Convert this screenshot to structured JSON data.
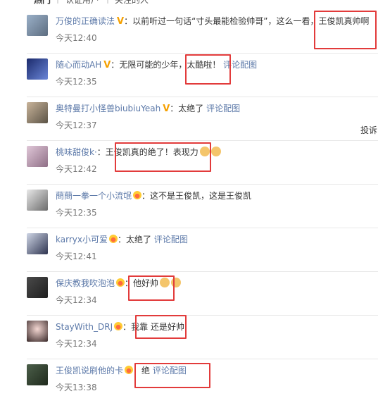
{
  "tabs": {
    "hot": "热门",
    "verified": "认证用户",
    "following": "关注的人"
  },
  "side_label": "投诉",
  "comments": [
    {
      "user": "万俊的正确读法",
      "badge": "V",
      "text": "以前听过一句话“寸头最能检验帅哥”，这么一看，王俊凯真帅啊",
      "link": "",
      "time": "今天12:40"
    },
    {
      "user": "随心而动AH",
      "badge": "V",
      "text": "无限可能的少年，太酷啦！",
      "link": "评论配图",
      "time": "今天12:35"
    },
    {
      "user": "奥特曼打小怪兽biubiuYeah",
      "badge": "V",
      "text": "太绝了",
      "link": "评论配图",
      "time": "今天12:37"
    },
    {
      "user": "桃味甜俊k·",
      "badge": "",
      "text": "王俊凯真的绝了！表现力",
      "link": "",
      "time": "今天12:42",
      "emoji_count": 2
    },
    {
      "user": "蔄蔄一拳一个小流氓",
      "badge": "crown",
      "text": "这不是王俊凯，这是王俊凯",
      "link": "",
      "time": "今天12:35"
    },
    {
      "user": "karryx小可爱",
      "badge": "crown",
      "text": "太绝了",
      "link": "评论配图",
      "time": "今天12:41"
    },
    {
      "user": "保庆教我吹泡泡",
      "badge": "crown",
      "text": "他好帅",
      "link": "",
      "time": "今天12:34",
      "emoji_count": 2
    },
    {
      "user": "StayWith_DRJ",
      "badge": "crown",
      "text": "我靠 还是好帅",
      "link": "",
      "time": "今天12:34"
    },
    {
      "user": "王俊凯说刷他的卡",
      "badge": "crown",
      "text": "绝",
      "link": "评论配图",
      "time": "今天13:38"
    }
  ],
  "colors": {
    "username": "#5b78a8",
    "highlight": "#e23b3b",
    "vbadge": "#f5a000"
  }
}
